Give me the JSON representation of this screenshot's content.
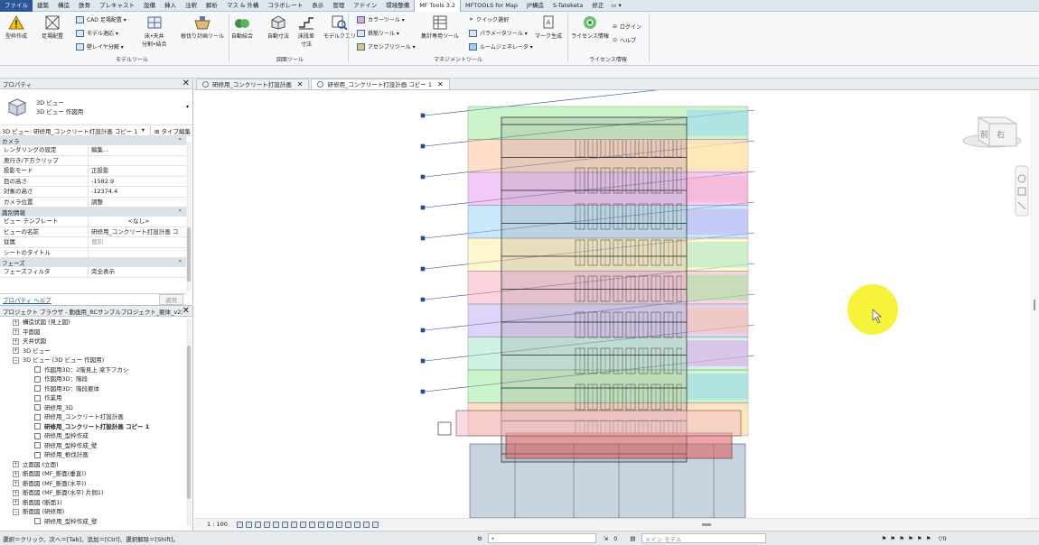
{
  "ribbon_tabs": [
    "ファイル",
    "建築",
    "構造",
    "鉄骨",
    "プレキャスト",
    "設備",
    "挿入",
    "注釈",
    "解析",
    "マス & 外構",
    "コラボレート",
    "表示",
    "管理",
    "アドイン",
    "環境整備",
    "MF Tools 3.2",
    "MFTOOLS for Map",
    "JP構造",
    "S-Tateketa",
    "修正"
  ],
  "ribbon_tab_extra": "▭ ▾",
  "active_tab_index": 15,
  "ribbon": {
    "katawaku": "型枠作成",
    "ashiba": "足場配置",
    "cad_ashiba": "CAD 足場配置 ▾",
    "model_tekiou": "モデル適応 ▾",
    "kabe_layer": "壁レイヤ分解 ▾",
    "yuka_tenjo_1": "床•天井",
    "yuka_tenjo_2": "分割•結合",
    "nekiri": "根伐り計画ツール",
    "jidou_ketsugou": "自動結合",
    "jidou_sunpou": "自動寸法",
    "yuka_dansa_1": "床段差",
    "yuka_dansa_2": "寸法",
    "model_query": "モデルクエリ",
    "color_tool": "カラーツール ▾",
    "tekkin_tool": "鉄筋ツール ▾",
    "assembly_tool": "アセンブリツール ▾",
    "shuukei": "集計専用ツール",
    "quick_select": "クイック選択",
    "param_tool": "パラメータツール ▾",
    "room_gen": "ルームジェネレータ ▾",
    "mark_seisei": "マーク生成",
    "license": "ライセンス情報",
    "login": "ログイン",
    "help": "ヘルプ",
    "group_model": "モデルツール",
    "group_zumen": "図面ツール",
    "group_manage": "マネジメントツール",
    "group_license": "ライセンス情報"
  },
  "properties": {
    "title": "プロパティ",
    "type_line1": "3D ビュー",
    "type_line2": "3D ビュー 作図用",
    "selector": "3D ビュー: 研修用_コンクリート打設計画 コピー 1",
    "selector_arrow": "▾",
    "edit_type": "⊞ タイプ編集",
    "sec_camera": "カメラ",
    "rows": [
      {
        "k": "レンダリングの設定",
        "v": "編集..."
      },
      {
        "k": "奥行き/下方クリップ",
        "v": ""
      },
      {
        "k": "投影モード",
        "v": "正投影"
      },
      {
        "k": "目の高さ",
        "v": "-1582.9"
      },
      {
        "k": "対象の高さ",
        "v": "-12374.4"
      },
      {
        "k": "カメラ位置",
        "v": "調整"
      }
    ],
    "sec_id": "識別情報",
    "rows2": [
      {
        "k": "ビュー テンプレート",
        "v": "<なし>"
      },
      {
        "k": "ビューの名前",
        "v": "研修用_コンクリート打設計画 コ"
      },
      {
        "k": "従属",
        "v": "個別"
      },
      {
        "k": "シートのタイトル",
        "v": ""
      }
    ],
    "sec_phase": "フェーズ",
    "rows3": [
      {
        "k": "フェーズフィルタ",
        "v": "完全表示"
      }
    ],
    "help_link": "プロパティ ヘルプ",
    "apply": "適用"
  },
  "browser": {
    "title": "プロジェクト ブラウザ - 動画用_RCサンプルプロジェクト_躯体_v23.rvt",
    "nodes": [
      {
        "t": "構造伏図 (見上図)",
        "lv": 1,
        "tg": "+"
      },
      {
        "t": "平面図",
        "lv": 1,
        "tg": "+"
      },
      {
        "t": "天井伏図",
        "lv": 1,
        "tg": "+"
      },
      {
        "t": "3D ビュー",
        "lv": 1,
        "tg": "+"
      },
      {
        "t": "3D ビュー (3D ビュー 作図用)",
        "lv": 1,
        "tg": "−"
      },
      {
        "t": "作図用3D：2階見上 梁下フカシ",
        "lv": 2,
        "tg": ""
      },
      {
        "t": "作図用3D：階段",
        "lv": 2,
        "tg": ""
      },
      {
        "t": "作図用3D：階段躯体",
        "lv": 2,
        "tg": ""
      },
      {
        "t": "作業用",
        "lv": 2,
        "tg": ""
      },
      {
        "t": "研修用_3D",
        "lv": 2,
        "tg": ""
      },
      {
        "t": "研修用_コンクリート打設計画",
        "lv": 2,
        "tg": ""
      },
      {
        "t": "研修用_コンクリート打設計画 コピー 1",
        "lv": 2,
        "tg": "",
        "b": true
      },
      {
        "t": "研修用_型枠作成",
        "lv": 2,
        "tg": ""
      },
      {
        "t": "研修用_型枠作成_壁",
        "lv": 2,
        "tg": ""
      },
      {
        "t": "研修用_根伐計画",
        "lv": 2,
        "tg": ""
      },
      {
        "t": "立面図 (立面)",
        "lv": 1,
        "tg": "+"
      },
      {
        "t": "断面図 (MF_断面(垂直))",
        "lv": 1,
        "tg": "+"
      },
      {
        "t": "断面図 (MF_断面(水平))",
        "lv": 1,
        "tg": "+"
      },
      {
        "t": "断面図 (MF_断面(水平) 片側1)",
        "lv": 1,
        "tg": "+"
      },
      {
        "t": "断面図 (断面1)",
        "lv": 1,
        "tg": "+"
      },
      {
        "t": "断面図 (研修用)",
        "lv": 1,
        "tg": "−"
      },
      {
        "t": "研修用_型枠作成_壁",
        "lv": 2,
        "tg": ""
      }
    ]
  },
  "view_tabs": [
    {
      "label": "研修用_コンクリート打設計画",
      "active": false
    },
    {
      "label": "研修用_コンクリート打設計画 コピー 1",
      "active": true
    }
  ],
  "viewcube": {
    "front": "前",
    "right": "右"
  },
  "scale": "1 : 100",
  "status": {
    "text": "選択＝クリック、次へ＝[Tab]、追加＝[Ctrl]、選択解除＝[Shift]。",
    "count": "0",
    "model": "メイン モデル",
    "filter": "0"
  }
}
